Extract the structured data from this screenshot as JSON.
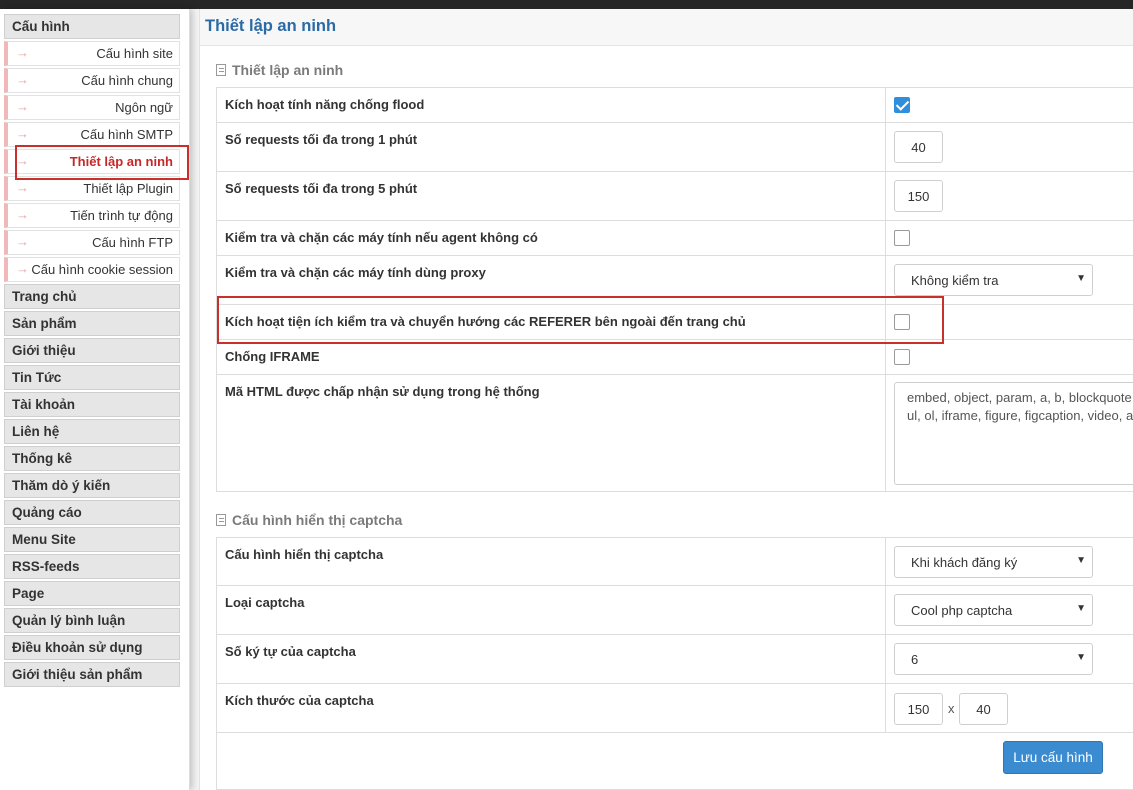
{
  "sidebar": {
    "header": "Cấu hình",
    "sub_items": [
      {
        "label": "Cấu hình site",
        "arrow": "→"
      },
      {
        "label": "Cấu hình chung",
        "arrow": "→"
      },
      {
        "label": "Ngôn ngữ",
        "arrow": "→"
      },
      {
        "label": "Cấu hình SMTP",
        "arrow": "→"
      },
      {
        "label": "Thiết lập an ninh",
        "arrow": "→"
      },
      {
        "label": "Thiết lập Plugin",
        "arrow": "→"
      },
      {
        "label": "Tiến trình tự động",
        "arrow": "→"
      },
      {
        "label": "Cấu hình FTP",
        "arrow": "→"
      },
      {
        "label": "Cấu hình cookie session",
        "arrow": "→"
      }
    ],
    "items": [
      "Trang chủ",
      "Sản phẩm",
      "Giới thiệu",
      "Tin Tức",
      "Tài khoản",
      "Liên hệ",
      "Thống kê",
      "Thăm dò ý kiến",
      "Quảng cáo",
      "Menu Site",
      "RSS-feeds",
      "Page",
      "Quản lý bình luận",
      "Điều khoản sử dụng",
      "Giới thiệu sản phẩm"
    ]
  },
  "main": {
    "page_title": "Thiết lập an ninh",
    "security": {
      "section_title": "Thiết lập an ninh",
      "flood_label": "Kích hoạt tính năng chống flood",
      "flood_checked": true,
      "req1_label": "Số requests tối đa trong 1 phút",
      "req1_value": "40",
      "req5_label": "Số requests tối đa trong 5 phút",
      "req5_value": "150",
      "agent_label": "Kiểm tra và chặn các máy tính nếu agent không có",
      "agent_checked": false,
      "proxy_label": "Kiểm tra và chặn các máy tính dùng proxy",
      "proxy_value": "Không kiểm tra",
      "referer_label": "Kích hoạt tiện ích kiểm tra và chuyển hướng các REFERER bên ngoài đến trang chủ",
      "referer_checked": false,
      "iframe_label": "Chống IFRAME",
      "iframe_checked": false,
      "html_label": "Mã HTML được chấp nhận sử dụng trong hệ thống",
      "html_line1": "embed, object, param, a, b, blockquote",
      "html_line2": "ul, ol, iframe, figure, figcaption, video, a"
    },
    "captcha": {
      "section_title": "Cấu hình hiển thị captcha",
      "display_label": "Cấu hình hiển thị captcha",
      "display_value": "Khi khách đăng ký",
      "type_label": "Loại captcha",
      "type_value": "Cool php captcha",
      "chars_label": "Số ký tự của captcha",
      "chars_value": "6",
      "size_label": "Kích thước của captcha",
      "width_value": "150",
      "times": "x",
      "height_value": "40"
    },
    "save_label": "Lưu cấu hình"
  },
  "colors": {
    "title": "#2a6aa5",
    "active_menu": "#c62828",
    "highlight_box": "#c9302c",
    "checkbox_checked": "#2f8fdc",
    "save_button": "#3a8bd0"
  },
  "icons": {
    "section": "document-icon",
    "select": "caret-down-icon",
    "check": "checkmark-icon"
  }
}
